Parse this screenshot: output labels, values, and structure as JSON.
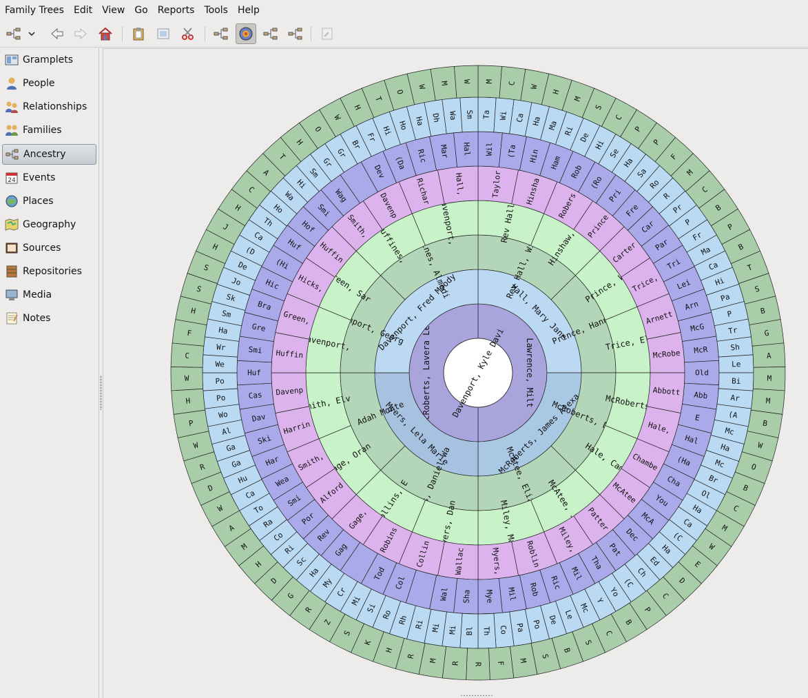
{
  "menubar": {
    "items": [
      "Family Trees",
      "Edit",
      "View",
      "Go",
      "Reports",
      "Tools",
      "Help"
    ]
  },
  "toolbar": {
    "buttons": [
      {
        "icon": "family-tree-icon"
      },
      {
        "icon": "dropdown-arrow-icon"
      },
      {
        "icon": "back-arrow-icon"
      },
      {
        "icon": "forward-arrow-icon"
      },
      {
        "icon": "home-icon"
      },
      {
        "icon": "clipboard-icon"
      },
      {
        "icon": "edit-image-icon"
      },
      {
        "icon": "scissors-icon"
      },
      {
        "icon": "pedigree-view-icon"
      },
      {
        "icon": "fan-chart-icon",
        "active": true
      },
      {
        "icon": "descendant-fan-icon"
      },
      {
        "icon": "two-way-fan-icon"
      },
      {
        "icon": "print-preview-icon"
      }
    ]
  },
  "sidebar": {
    "items": [
      {
        "label": "Gramplets",
        "icon": "gramplets-icon"
      },
      {
        "label": "People",
        "icon": "person-icon"
      },
      {
        "label": "Relationships",
        "icon": "relationships-icon"
      },
      {
        "label": "Families",
        "icon": "families-icon"
      },
      {
        "label": "Ancestry",
        "icon": "ancestry-icon",
        "active": true
      },
      {
        "label": "Events",
        "icon": "events-icon"
      },
      {
        "label": "Places",
        "icon": "globe-icon"
      },
      {
        "label": "Geography",
        "icon": "map-icon"
      },
      {
        "label": "Sources",
        "icon": "sources-icon"
      },
      {
        "label": "Repositories",
        "icon": "repositories-icon"
      },
      {
        "label": "Media",
        "icon": "media-icon"
      },
      {
        "label": "Notes",
        "icon": "notes-icon"
      }
    ]
  },
  "fanchart": {
    "center": {
      "name": "Davenport, Kyle Davi"
    },
    "colors": {
      "ring1": "#a9a4dc",
      "ring2": [
        "#bcd9f3",
        "#a9c8e4",
        "#a7c1e0",
        "#bcd9f3"
      ],
      "ring3": "#b4d6b8",
      "ring4": "#c8f2c8",
      "ring5": "#dcb3ec",
      "ring6": "#aaaaea",
      "ring7": "#bad9f3",
      "outer": "#a9cda9",
      "outline": "#222222"
    },
    "generations": [
      {
        "names": [
          "Lawrence, Milt",
          "McRoberts, Lavera Lee"
        ]
      },
      {
        "names": [
          "Hall, Mary Jane",
          "McRoberts, James Alexa",
          "Myers, Lela Marie",
          "Davenport, Fred Moody"
        ]
      },
      {
        "names": [
          "Rev Hall, Willia",
          "Prince, Hannah T",
          "McRoberts, David",
          "McAtee, Elizabet",
          "Myers, Daniel Wa",
          "Gage, Adah Monte",
          "Davenport, Georg",
          "Huffines, Almedi"
        ]
      },
      {
        "names": [
          "Rev Hall,",
          "Hinshaw, M",
          "Prince, Wi",
          "Trice, Eli",
          "McRoberts,",
          "Hale, Cami",
          "McAtee, Ja",
          "Miley, Mar",
          "Myers, Dan",
          "Collins, E",
          "Gage, Oran",
          "Smith, Elv",
          "Davenport,",
          "Green, Sar",
          "Huffines,",
          "Davenport,"
        ]
      },
      {
        "names": [
          "Taylor",
          "Hinsha",
          "Robers",
          "Prince",
          "Carter",
          "Trice,",
          "Arnett",
          "McRobe",
          "Abbott",
          "Hale,",
          "Chambe",
          "McAtee",
          "Patter",
          "Miley,",
          "Roblin",
          "Myers,",
          "Wallac",
          "Collin",
          "Robins",
          "Gage,",
          "Alford",
          "Smith,",
          "Harrin",
          "Davenp",
          "Huffin",
          "Green,",
          "Hicks,",
          "Huffin",
          "Smith,",
          "Davenp",
          "Richar",
          "Hall,"
        ]
      },
      {
        "names": [
          "Wil",
          "(Ta",
          "Hin",
          "Ham",
          "Rob",
          "(Ro",
          "Pri",
          "Fre",
          "Car",
          "Par",
          "Tri",
          "Lei",
          "Arn",
          "McG",
          "McR",
          "Old",
          "Abb",
          "E",
          "Hal",
          "(Ha",
          "Cha",
          "You",
          "McA",
          "Dec",
          "Pat",
          "Tha",
          "Mil",
          "Ric",
          "Rob",
          "Mil",
          "Mye",
          "Sha",
          "Wal",
          "",
          "Col",
          "Tod",
          "",
          "Gag",
          "Rev",
          "Por",
          "Smi",
          "Wea",
          "Har",
          "Ski",
          "Dav",
          "Cas",
          "Huf",
          "Smi",
          "Gre",
          "Bra",
          "Hic",
          "(Hi",
          "Huf",
          "Hof",
          "Smi",
          "Wag",
          "",
          "Dev",
          "(Da",
          "Ric",
          "Mar",
          "Hal"
        ]
      },
      {
        "names": [
          "Ta",
          "Wi",
          "Ca",
          "Ha",
          "Ma",
          "Ri",
          "De",
          "Hi",
          "Se",
          "Ha",
          "Sa",
          "Ro",
          "R",
          "Pr",
          "P",
          "Fr",
          "Ma",
          "Ca",
          "Hi",
          "Pa",
          "P",
          "Tr",
          "Sh",
          "Le",
          "Bi",
          "Ar",
          "(A",
          "Mc",
          "Ha",
          "Mc",
          "Br",
          "Ol",
          "Ha",
          "Ca",
          "(C",
          "Ha",
          "Ed",
          "Ch",
          "(C",
          "Yo",
          "Y",
          "Mc",
          "Le",
          "De",
          "Po",
          "Pa",
          "Co",
          "Th",
          "Bl",
          "Mi",
          "Mi",
          "Ri",
          "Rh",
          "Ro",
          "Si",
          "Mi",
          "Cr",
          "My",
          "Ha",
          "Sc",
          "Ri",
          "Co",
          "Ra",
          "To",
          "Ca",
          "Hu",
          "Ga",
          "Ga",
          "Al",
          "Wo",
          "Po",
          "Po",
          "We",
          "Wr",
          "Ha",
          "Sm",
          "Sk",
          "Jo",
          "De",
          "(D",
          "Ca",
          "Th",
          "Ho",
          "Wa",
          "Hi",
          "Sm",
          "Gr",
          "Gr",
          "Br",
          "Fr",
          "Hi",
          "Ho",
          "Ha",
          "Dh",
          "Wa",
          "Sm"
        ]
      },
      {
        "names": [
          "M",
          "C",
          "W",
          "H",
          "M",
          "S",
          "C",
          "P",
          "P",
          "F",
          "M",
          "C",
          "B",
          "P",
          "B",
          "T",
          "S",
          "B",
          "G",
          "A",
          "M",
          "M",
          "B",
          "W",
          "O",
          "B",
          "C",
          "M",
          "W",
          "E",
          "D",
          "C",
          "P",
          "B",
          "C",
          "S",
          "B",
          "S",
          "M",
          "F",
          "R",
          "R",
          "M",
          "R",
          "H",
          "K",
          "S",
          "Z",
          "R",
          "G",
          "D",
          "H",
          "M",
          "A",
          "W",
          "D",
          "R",
          "W",
          "P",
          "H",
          "W",
          "C",
          "F",
          "H",
          "S",
          "S",
          "H",
          "J",
          "H",
          "C",
          "A",
          "T",
          "H",
          "O",
          "W",
          "H",
          "T",
          "O",
          "W",
          "M",
          "W"
        ]
      }
    ]
  }
}
